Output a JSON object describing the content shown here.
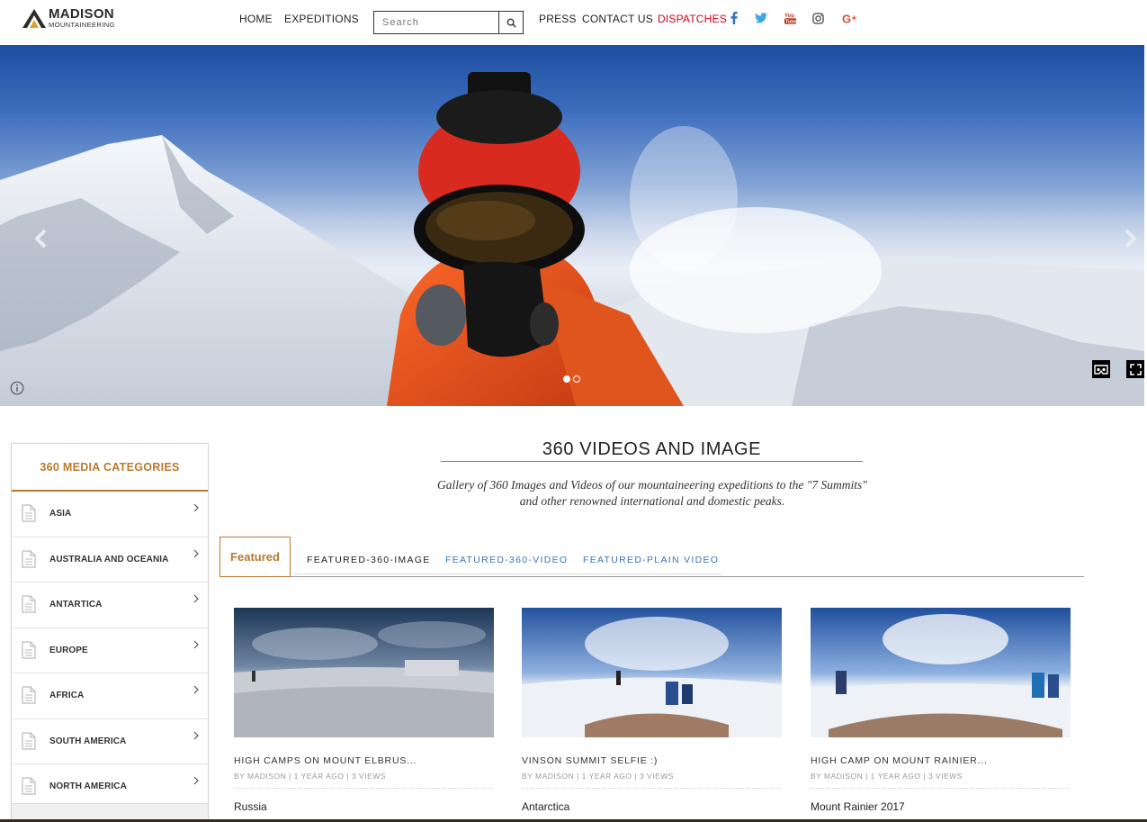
{
  "brand": {
    "name": "MADISON",
    "tagline": "MOUNTAINEERING"
  },
  "nav": {
    "home": "HOME",
    "expeditions": "EXPEDITIONS",
    "press": "PRESS",
    "contact": "CONTACT US",
    "dispatches": "DISPATCHES"
  },
  "search": {
    "placeholder": "Search",
    "value": ""
  },
  "social": [
    "facebook-icon",
    "twitter-icon",
    "youtube-icon",
    "instagram-icon",
    "google-plus-icon"
  ],
  "hero": {
    "slides": 2,
    "active_slide": 1
  },
  "sidebar": {
    "title": "360 MEDIA CATEGORIES",
    "items": [
      {
        "label": "ASIA"
      },
      {
        "label": "AUSTRALIA AND OCEANIA"
      },
      {
        "label": "ANTARTICA"
      },
      {
        "label": "EUROPE"
      },
      {
        "label": "AFRICA"
      },
      {
        "label": "SOUTH AMERICA"
      },
      {
        "label": "NORTH AMERICA"
      }
    ]
  },
  "main": {
    "title": "360 VIDEOS AND IMAGE",
    "subtitle": "Gallery of 360 Images and Videos of our mountaineering expeditions to the \"7 Summits\" and other renowned international and domestic peaks.",
    "tabs": [
      {
        "label": "Featured",
        "active": true
      },
      {
        "label": "FEATURED-360-IMAGE"
      },
      {
        "label": "FEATURED-360-VIDEO"
      },
      {
        "label": "FEATURED-PLAIN VIDEO"
      }
    ],
    "cards": [
      {
        "title": "HIGH CAMPS ON MOUNT ELBRUS...",
        "meta": "BY MADISON  | 1 YEAR AGO | 3 VIEWS",
        "location": "Russia"
      },
      {
        "title": "VINSON SUMMIT SELFIE :)",
        "meta": "BY MADISON  | 1 YEAR AGO | 3 VIEWS",
        "location": "Antarctica"
      },
      {
        "title": "HIGH CAMP ON MOUNT RAINIER...",
        "meta": "BY MADISON  | 1 YEAR AGO | 3 VIEWS",
        "location": "Mount Rainier 2017"
      }
    ]
  },
  "colors": {
    "accent": "#b97a2e",
    "dispatches": "#d0021b",
    "tab_blue": "#3b73b9"
  }
}
